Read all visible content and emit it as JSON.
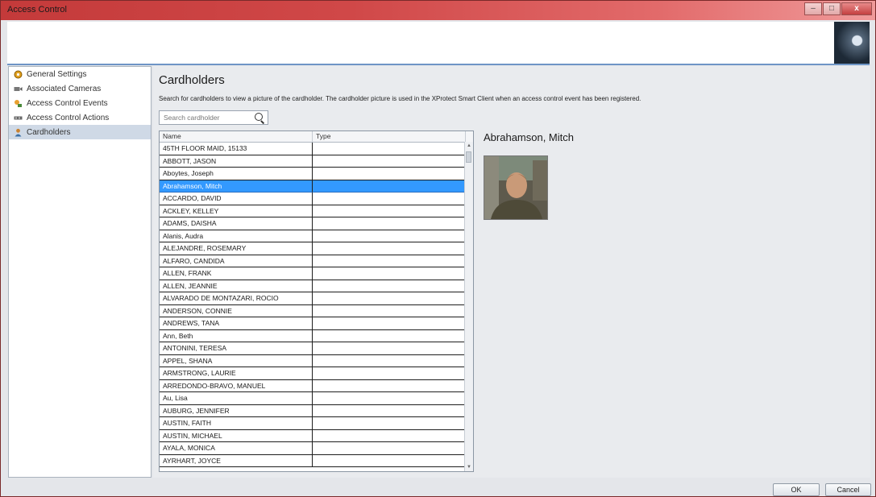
{
  "window": {
    "title": "Access Control",
    "controls": {
      "minimize": "–",
      "maximize": "□",
      "close": "x"
    }
  },
  "sidebar": {
    "items": [
      {
        "label": "General Settings",
        "icon": "settings-icon"
      },
      {
        "label": "Associated Cameras",
        "icon": "camera-icon"
      },
      {
        "label": "Access Control Events",
        "icon": "events-icon"
      },
      {
        "label": "Access Control Actions",
        "icon": "actions-icon"
      },
      {
        "label": "Cardholders",
        "icon": "cardholder-icon",
        "active": true
      }
    ]
  },
  "main": {
    "title": "Cardholders",
    "description": "Search for cardholders to view a picture of the cardholder. The cardholder picture is used in the XProtect Smart Client when an access control event has been registered.",
    "search": {
      "placeholder": "Search cardholder",
      "value": ""
    },
    "grid": {
      "columns": [
        "Name",
        "Type"
      ],
      "rows": [
        "45TH FLOOR MAID, 15133",
        "ABBOTT, JASON",
        "Aboytes, Joseph",
        "Abrahamson, Mitch",
        "ACCARDO, DAVID",
        "ACKLEY, KELLEY",
        "ADAMS, DAISHA",
        "Alanis, Audra",
        "ALEJANDRE, ROSEMARY",
        "ALFARO, CANDIDA",
        "ALLEN, FRANK",
        "ALLEN, JEANNIE",
        "ALVARADO DE MONTAZARI, ROCIO",
        "ANDERSON, CONNIE",
        "ANDREWS, TANA",
        "Ann, Beth",
        "ANTONINI, TERESA",
        "APPEL, SHANA",
        "ARMSTRONG, LAURIE",
        "ARREDONDO-BRAVO, MANUEL",
        "Au, Lisa",
        "AUBURG, JENNIFER",
        "AUSTIN, FAITH",
        "AUSTIN, MICHAEL",
        "AYALA, MONICA",
        "AYRHART, JOYCE"
      ],
      "selected_index": 3
    },
    "detail": {
      "name": "Abrahamson, Mitch"
    }
  },
  "footer": {
    "ok_label": "OK",
    "cancel_label": "Cancel"
  },
  "colors": {
    "titlebar": "#c43a3a",
    "selection": "#3399ff",
    "banner_border": "#6e95c6"
  }
}
